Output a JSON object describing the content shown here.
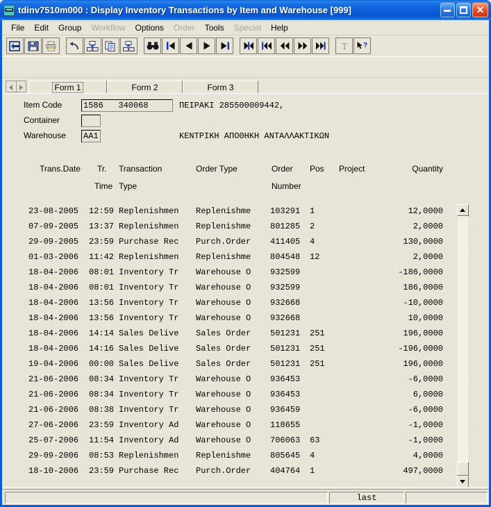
{
  "window": {
    "title": "tdinv7510m000 : Display Inventory Transactions by Item and Warehouse [999]",
    "icon": "baan-app-icon",
    "minimize_label": "_",
    "maximize_label": "",
    "close_label": "✕"
  },
  "menubar": [
    {
      "label": "File",
      "disabled": false
    },
    {
      "label": "Edit",
      "disabled": false
    },
    {
      "label": "Group",
      "disabled": false
    },
    {
      "label": "Workflow",
      "disabled": true
    },
    {
      "label": "Options",
      "disabled": false
    },
    {
      "label": "Order",
      "disabled": true
    },
    {
      "label": "Tools",
      "disabled": false
    },
    {
      "label": "Special",
      "disabled": true
    },
    {
      "label": "Help",
      "disabled": false
    }
  ],
  "toolbar": [
    {
      "name": "exit-icon",
      "group": 0
    },
    {
      "name": "save-icon",
      "group": 0
    },
    {
      "name": "print-icon",
      "group": 0
    },
    {
      "name": "undo-icon",
      "group": 1
    },
    {
      "name": "cut-icon",
      "group": 1
    },
    {
      "name": "copy-icon",
      "group": 1
    },
    {
      "name": "paste-icon",
      "group": 1
    },
    {
      "name": "find-icon",
      "group": 2
    },
    {
      "name": "first-record-icon",
      "group": 2
    },
    {
      "name": "previous-record-icon",
      "group": 2
    },
    {
      "name": "next-record-icon",
      "group": 2
    },
    {
      "name": "last-record-icon",
      "group": 2
    },
    {
      "name": "first-set-icon",
      "group": 3
    },
    {
      "name": "previous-set-icon",
      "group": 3
    },
    {
      "name": "rewind-icon",
      "group": 3
    },
    {
      "name": "forward-icon",
      "group": 3
    },
    {
      "name": "end-set-icon",
      "group": 3
    },
    {
      "name": "text-icon",
      "group": 4
    },
    {
      "name": "help-cursor-icon",
      "group": 4
    }
  ],
  "tabs": {
    "prev_label": "◀",
    "next_label": "▶",
    "items": [
      {
        "label": "Form 1",
        "selected": true
      },
      {
        "label": "Form 2",
        "selected": false
      },
      {
        "label": "Form 3",
        "selected": false
      }
    ]
  },
  "fields": {
    "item_code": {
      "label": "Item Code",
      "value": "1586   340068",
      "description": "ΠΕΙΡΑΚΙ 285500009442,"
    },
    "container": {
      "label": "Container",
      "value": "",
      "description": ""
    },
    "warehouse": {
      "label": "Warehouse",
      "value": "AA1",
      "description": "ΚΕΝΤΡΙΚΗ ΑΠΟΘΗΚΗ ΑΝΤΑΛΛΑΚΤΙΚΩΝ"
    }
  },
  "table": {
    "headers": [
      {
        "line1": "Trans.Date",
        "line2": ""
      },
      {
        "line1": "Tr.",
        "line2": "Time"
      },
      {
        "line1": "Transaction",
        "line2": "Type"
      },
      {
        "line1": "Order Type",
        "line2": ""
      },
      {
        "line1": "Order",
        "line2": "Number"
      },
      {
        "line1": "Pos",
        "line2": ""
      },
      {
        "line1": "Project",
        "line2": ""
      },
      {
        "line1": "Quantity",
        "line2": ""
      }
    ],
    "rows": [
      {
        "date": "23-08-2005",
        "time": "12:59",
        "type": "Replenishmen",
        "order_type": "Replenishme",
        "order_number": "103291",
        "pos": "1",
        "project": "",
        "quantity": "12,0000"
      },
      {
        "date": "07-09-2005",
        "time": "13:37",
        "type": "Replenishmen",
        "order_type": "Replenishme",
        "order_number": "801285",
        "pos": "2",
        "project": "",
        "quantity": "2,0000"
      },
      {
        "date": "29-09-2005",
        "time": "23:59",
        "type": "Purchase Rec",
        "order_type": "Purch.Order",
        "order_number": "411405",
        "pos": "4",
        "project": "",
        "quantity": "130,0000"
      },
      {
        "date": "01-03-2006",
        "time": "11:42",
        "type": "Replenishmen",
        "order_type": "Replenishme",
        "order_number": "804548",
        "pos": "12",
        "project": "",
        "quantity": "2,0000"
      },
      {
        "date": "18-04-2006",
        "time": "08:01",
        "type": "Inventory Tr",
        "order_type": "Warehouse O",
        "order_number": "932599",
        "pos": "",
        "project": "",
        "quantity": "-186,0000"
      },
      {
        "date": "18-04-2006",
        "time": "08:01",
        "type": "Inventory Tr",
        "order_type": "Warehouse O",
        "order_number": "932599",
        "pos": "",
        "project": "",
        "quantity": "186,0000"
      },
      {
        "date": "18-04-2006",
        "time": "13:56",
        "type": "Inventory Tr",
        "order_type": "Warehouse O",
        "order_number": "932668",
        "pos": "",
        "project": "",
        "quantity": "-10,0000"
      },
      {
        "date": "18-04-2006",
        "time": "13:56",
        "type": "Inventory Tr",
        "order_type": "Warehouse O",
        "order_number": "932668",
        "pos": "",
        "project": "",
        "quantity": "10,0000"
      },
      {
        "date": "18-04-2006",
        "time": "14:14",
        "type": "Sales Delive",
        "order_type": "Sales Order",
        "order_number": "501231",
        "pos": "251",
        "project": "",
        "quantity": "196,0000"
      },
      {
        "date": "18-04-2006",
        "time": "14:16",
        "type": "Sales Delive",
        "order_type": "Sales Order",
        "order_number": "501231",
        "pos": "251",
        "project": "",
        "quantity": "-196,0000"
      },
      {
        "date": "19-04-2006",
        "time": "00:00",
        "type": "Sales Delive",
        "order_type": "Sales Order",
        "order_number": "501231",
        "pos": "251",
        "project": "",
        "quantity": "196,0000"
      },
      {
        "date": "21-06-2006",
        "time": "08:34",
        "type": "Inventory Tr",
        "order_type": "Warehouse O",
        "order_number": "936453",
        "pos": "",
        "project": "",
        "quantity": "-6,0000"
      },
      {
        "date": "21-06-2006",
        "time": "08:34",
        "type": "Inventory Tr",
        "order_type": "Warehouse O",
        "order_number": "936453",
        "pos": "",
        "project": "",
        "quantity": "6,0000"
      },
      {
        "date": "21-06-2006",
        "time": "08:38",
        "type": "Inventory Tr",
        "order_type": "Warehouse O",
        "order_number": "936459",
        "pos": "",
        "project": "",
        "quantity": "-6,0000"
      },
      {
        "date": "27-06-2006",
        "time": "23:59",
        "type": "Inventory Ad",
        "order_type": "Warehouse O",
        "order_number": "118655",
        "pos": "",
        "project": "",
        "quantity": "-1,0000"
      },
      {
        "date": "25-07-2006",
        "time": "11:54",
        "type": "Inventory Ad",
        "order_type": "Warehouse O",
        "order_number": "706063",
        "pos": "63",
        "project": "",
        "quantity": "-1,0000"
      },
      {
        "date": "29-09-2006",
        "time": "08:53",
        "type": "Replenishmen",
        "order_type": "Replenishme",
        "order_number": "805645",
        "pos": "4",
        "project": "",
        "quantity": "4,0000"
      },
      {
        "date": "18-10-2006",
        "time": "23:59",
        "type": "Purchase Rec",
        "order_type": "Purch.Order",
        "order_number": "404764",
        "pos": "1",
        "project": "",
        "quantity": "497,0000"
      }
    ]
  },
  "scrollbar": {
    "up_label": "▲",
    "down_label": "▼"
  },
  "statusbar": {
    "left": "",
    "middle": "last",
    "right": ""
  },
  "colors": {
    "window_bg": "#e8e4d7",
    "titlebar": "#0f62dc",
    "titlebar_text": "#ffffff",
    "border": "#0a5cd5",
    "close_button": "#c8341a"
  }
}
